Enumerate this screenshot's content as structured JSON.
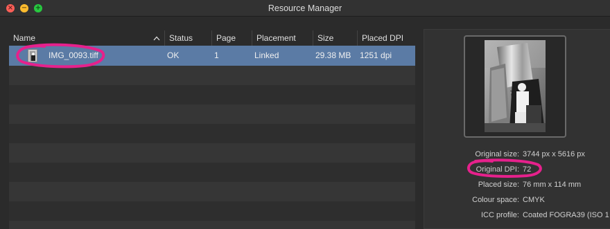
{
  "window": {
    "title": "Resource Manager",
    "buttons": {
      "close": "close",
      "minimize": "minimize",
      "maximize": "maximize"
    }
  },
  "table": {
    "columns": [
      "Name",
      "Status",
      "Page",
      "Placement",
      "Size",
      "Placed DPI"
    ],
    "sort_icon": "chevron-up-icon",
    "rows": [
      {
        "name": "IMG_0093.tiff",
        "status": "OK",
        "page": "1",
        "placement": "Linked",
        "size": "29.38 MB",
        "placed_dpi": "1251 dpi"
      }
    ]
  },
  "details": {
    "original_size_label": "Original size:",
    "original_size_value": "3744 px x 5616 px",
    "original_dpi_label": "Original DPI:",
    "original_dpi_value": "72",
    "placed_size_label": "Placed size:",
    "placed_size_value": "76 mm x 114 mm",
    "colour_space_label": "Colour space:",
    "colour_space_value": "CMYK",
    "icc_profile_label": "ICC profile:",
    "icc_profile_value": "Coated FOGRA39 (ISO 1"
  },
  "colors": {
    "selection": "#5b7ba5",
    "annotation": "#e6218c",
    "window_bg": "#2b2b2b"
  }
}
